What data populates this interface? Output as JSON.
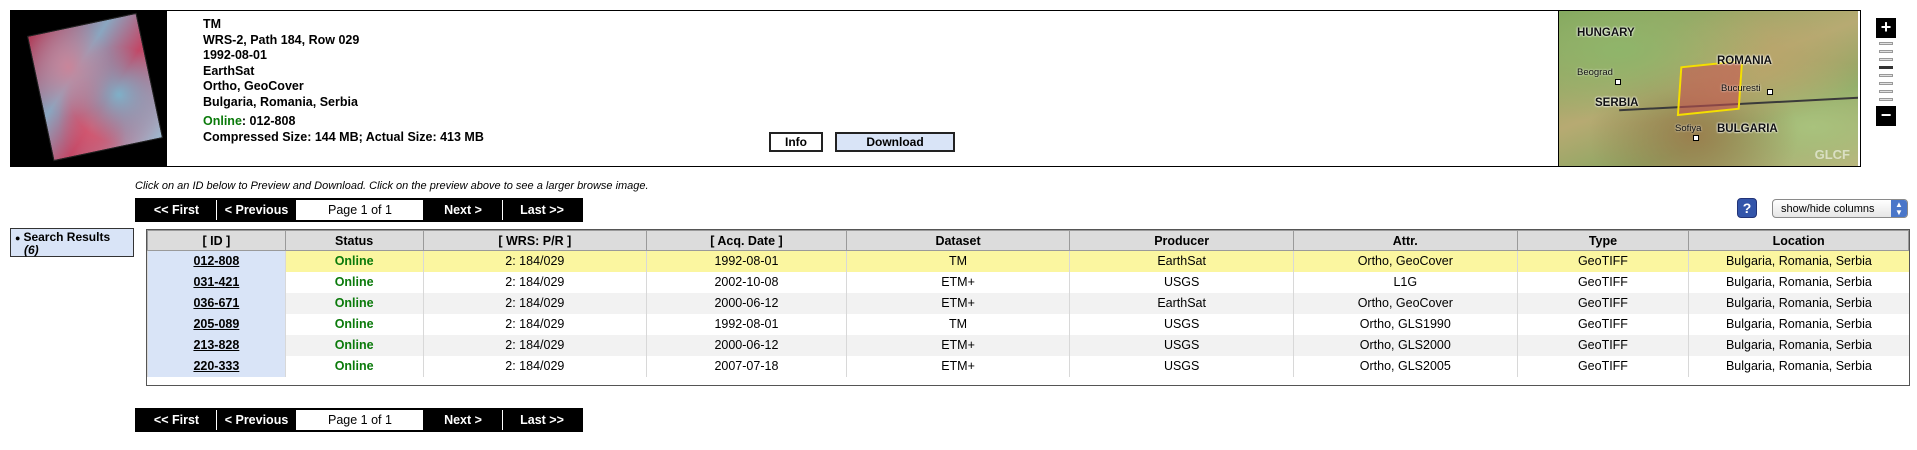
{
  "scene": {
    "sensor": "TM",
    "wrs": "WRS-2, Path 184, Row 029",
    "date": "1992-08-01",
    "producer": "EarthSat",
    "attributes": "Ortho, GeoCover",
    "location": "Bulgaria, Romania, Serbia",
    "online_label": "Online",
    "online_id": ": 012-808",
    "size": "Compressed Size: 144 MB; Actual Size: 413 MB",
    "info_button": "Info",
    "download_button": "Download"
  },
  "map": {
    "labels": {
      "hungary": "HUNGARY",
      "romania": "ROMANIA",
      "serbia": "SERBIA",
      "bulgaria": "BULGARIA"
    },
    "cities": {
      "belgrad": "Beograd",
      "bucuresti": "Bucuresti",
      "sofiya": "Sofiya"
    },
    "watermark": "GLCF"
  },
  "zoom": {
    "plus": "+",
    "minus": "−",
    "level": 4
  },
  "instructions": "Click on an ID below to Preview and Download. Click on the preview above to see a larger browse image.",
  "pagination": {
    "first": "<< First",
    "previous": "< Previous",
    "page_info": "Page 1 of 1",
    "next": "Next >",
    "last": "Last >>"
  },
  "help_icon": "?",
  "columns_select": "show/hide columns",
  "sidebar": {
    "results_label": "Search Results",
    "results_count": "(6)"
  },
  "table": {
    "headers": {
      "id": "[ ID ]",
      "status": "Status",
      "wrs": "[ WRS: P/R ]",
      "date": "[ Acq. Date ]",
      "dataset": "Dataset",
      "producer": "Producer",
      "attr": "Attr.",
      "type": "Type",
      "location": "Location"
    },
    "rows": [
      {
        "id": "012-808",
        "status": "Online",
        "wrs": "2: 184/029",
        "date": "1992-08-01",
        "dataset": "TM",
        "producer": "EarthSat",
        "attr": "Ortho, GeoCover",
        "type": "GeoTIFF",
        "location": "Bulgaria, Romania, Serbia"
      },
      {
        "id": "031-421",
        "status": "Online",
        "wrs": "2: 184/029",
        "date": "2002-10-08",
        "dataset": "ETM+",
        "producer": "USGS",
        "attr": "L1G",
        "type": "GeoTIFF",
        "location": "Bulgaria, Romania, Serbia"
      },
      {
        "id": "036-671",
        "status": "Online",
        "wrs": "2: 184/029",
        "date": "2000-06-12",
        "dataset": "ETM+",
        "producer": "EarthSat",
        "attr": "Ortho, GeoCover",
        "type": "GeoTIFF",
        "location": "Bulgaria, Romania, Serbia"
      },
      {
        "id": "205-089",
        "status": "Online",
        "wrs": "2: 184/029",
        "date": "1992-08-01",
        "dataset": "TM",
        "producer": "USGS",
        "attr": "Ortho, GLS1990",
        "type": "GeoTIFF",
        "location": "Bulgaria, Romania, Serbia"
      },
      {
        "id": "213-828",
        "status": "Online",
        "wrs": "2: 184/029",
        "date": "2000-06-12",
        "dataset": "ETM+",
        "producer": "USGS",
        "attr": "Ortho, GLS2000",
        "type": "GeoTIFF",
        "location": "Bulgaria, Romania, Serbia"
      },
      {
        "id": "220-333",
        "status": "Online",
        "wrs": "2: 184/029",
        "date": "2007-07-18",
        "dataset": "ETM+",
        "producer": "USGS",
        "attr": "Ortho, GLS2005",
        "type": "GeoTIFF",
        "location": "Bulgaria, Romania, Serbia"
      }
    ]
  },
  "colors": {
    "online": "#0a7a0a",
    "selected_row": "#fbf6a0",
    "id_cell": "#d9e4f7",
    "footprint": "#f3e000"
  }
}
